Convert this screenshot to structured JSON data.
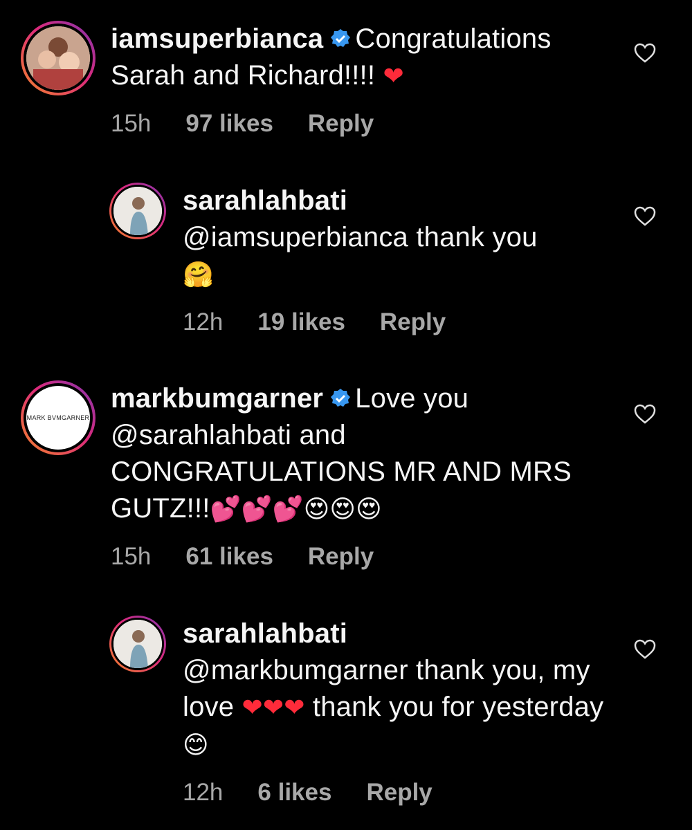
{
  "comments": [
    {
      "username": "iamsuperbianca",
      "verified": true,
      "text": "Congratulations Sarah and Richard!!!!",
      "emoji": "❤",
      "time": "15h",
      "likes": "97 likes",
      "reply": "Reply"
    },
    {
      "username": "sarahlahbati",
      "verified": false,
      "mention": "@iamsuperbianca",
      "text": " thank you",
      "emoji": "🤗",
      "time": "12h",
      "likes": "19 likes",
      "reply": "Reply"
    },
    {
      "username": "markbumgarner",
      "verified": true,
      "avatar_text": "MARK BVMGARNER",
      "text_before": "Love you ",
      "mention": "@sarahlahbati",
      "text_after": "  and CONGRATULATIONS MR AND MRS GUTZ!!!",
      "emoji_hearts": "💕💕💕",
      "emoji_faces": "😍😍😍",
      "time": "15h",
      "likes": "61 likes",
      "reply": "Reply"
    },
    {
      "username": "sarahlahbati",
      "verified": false,
      "mention": "@markbumgarner",
      "text_before": " thank you, my love ",
      "emoji_hearts": "❤❤❤",
      "text_after": " thank you for yesterday",
      "emoji_end": "😊",
      "time": "12h",
      "likes": "6 likes",
      "reply": "Reply"
    }
  ],
  "icons": {
    "like": "heart-outline-icon",
    "verified": "verified-badge-icon"
  },
  "colors": {
    "background": "#000000",
    "text": "#f5f5f5",
    "meta": "#a8a8a8",
    "verified": "#3897f0"
  }
}
